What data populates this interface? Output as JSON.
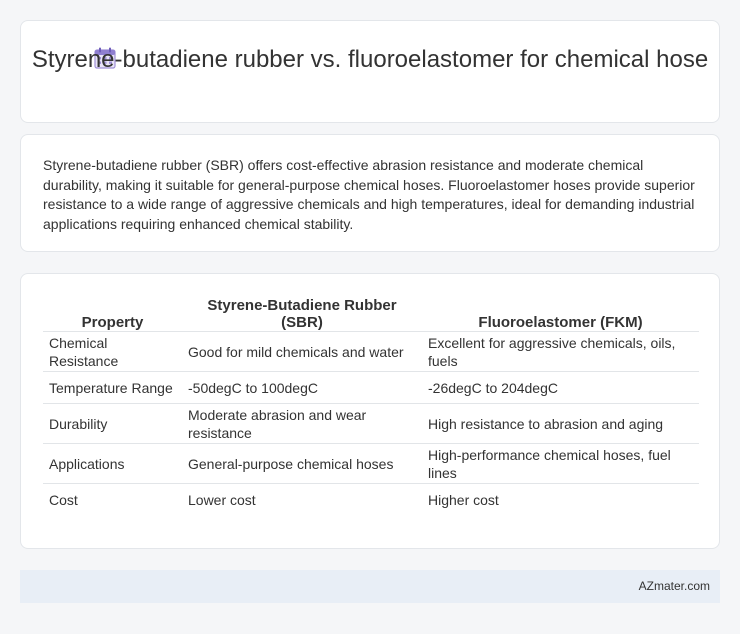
{
  "header": {
    "title": "Styrene-butadiene rubber vs. fluoroelastomer for chemical hose",
    "icon": "calendar-icon"
  },
  "summary": {
    "text": "Styrene-butadiene rubber (SBR) offers cost-effective abrasion resistance and moderate chemical durability, making it suitable for general-purpose chemical hoses. Fluoroelastomer hoses provide superior resistance to a wide range of aggressive chemicals and high temperatures, ideal for demanding industrial applications requiring enhanced chemical stability."
  },
  "table": {
    "headers": [
      "Property",
      "Styrene-Butadiene Rubber (SBR)",
      "Fluoroelastomer (FKM)"
    ],
    "rows": [
      [
        "Chemical Resistance",
        "Good for mild chemicals and water",
        "Excellent for aggressive chemicals, oils, fuels"
      ],
      [
        "Temperature Range",
        "-50degC to 100degC",
        "-26degC to 204degC"
      ],
      [
        "Durability",
        "Moderate abrasion and wear resistance",
        "High resistance to abrasion and aging"
      ],
      [
        "Applications",
        "General-purpose chemical hoses",
        "High-performance chemical hoses, fuel lines"
      ],
      [
        "Cost",
        "Lower cost",
        "Higher cost"
      ]
    ]
  },
  "footer": {
    "brand": "AZmater.com"
  },
  "colors": {
    "background": "#f5f6f8",
    "card": "#ffffff",
    "footer_bg": "#e8eef6",
    "text": "#333333"
  }
}
